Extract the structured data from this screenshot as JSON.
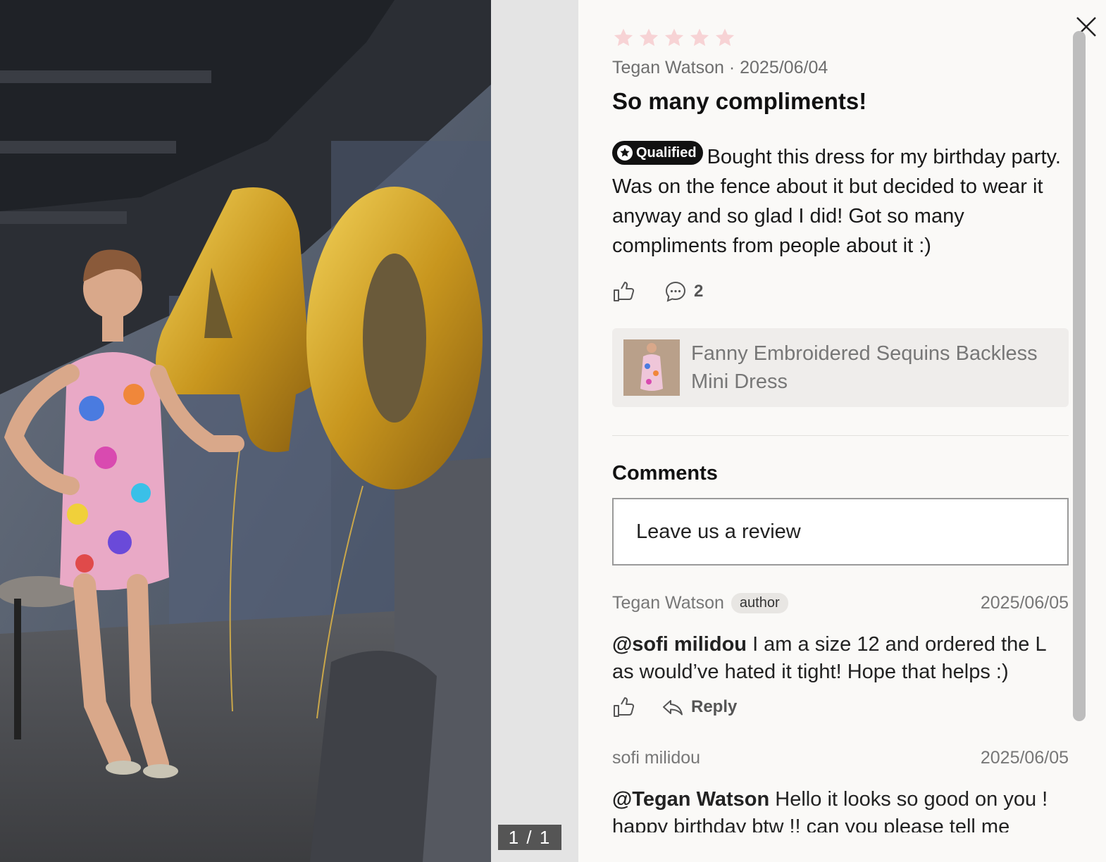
{
  "gallery": {
    "counter": "1 / 1"
  },
  "review": {
    "rating": 5,
    "star_color": "#f7d3d5",
    "author": "Tegan Watson",
    "date": "2025/06/04",
    "title": "So many compliments!",
    "badge": "Qualified",
    "body": "Bought this dress for my birthday party. Was on the fence about it but decided to wear it anyway and so glad I did! Got so many compliments from people about it :)",
    "comment_count": "2"
  },
  "product": {
    "name": "Fanny Embroidered Sequins Backless Mini Dress"
  },
  "comments": {
    "title": "Comments",
    "input_placeholder": "Leave us a review",
    "items": [
      {
        "author": "Tegan Watson",
        "tag": "author",
        "date": "2025/06/05",
        "mention": "@sofi milidou",
        "text": "I am a size 12 and ordered the L as would’ve hated it tight! Hope that helps :)",
        "reply_label": "Reply"
      },
      {
        "author": "sofi milidou",
        "date": "2025/06/05",
        "mention": "@Tegan Watson",
        "text": "Hello it looks so good on you ! happy birthday btw !! can you please tell me"
      }
    ]
  }
}
